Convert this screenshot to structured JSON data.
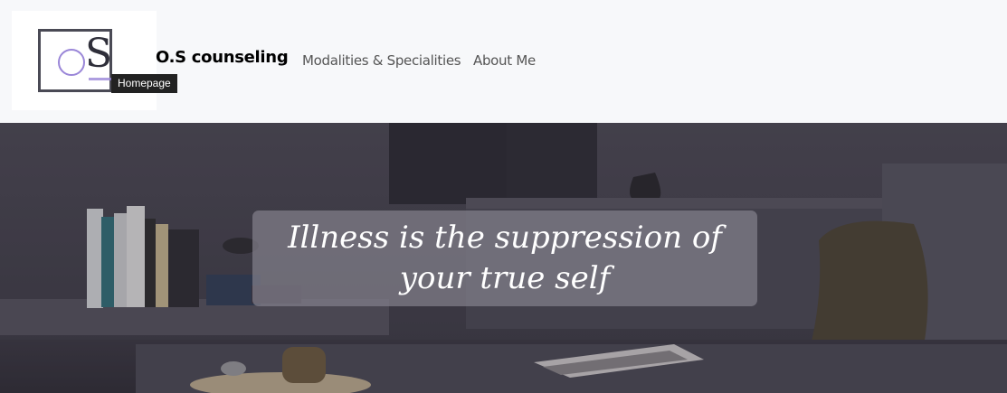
{
  "navbar": {
    "logo": {
      "letters": "S",
      "tooltip": "Homepage",
      "colors": {
        "frame": "#4a4a55",
        "accent": "#9a86d8",
        "letter": "#2f2f3a"
      }
    },
    "brand": "O.S counseling",
    "links": [
      {
        "label": "Modalities & Specialities"
      },
      {
        "label": "About Me"
      }
    ],
    "background": "#f7f8fa"
  },
  "hero": {
    "quote": "Illness is the suppression of your true self",
    "image_description_icon": "living-room-photo",
    "colors": {
      "overlay": "#82808a",
      "text": "#ffffff"
    }
  }
}
